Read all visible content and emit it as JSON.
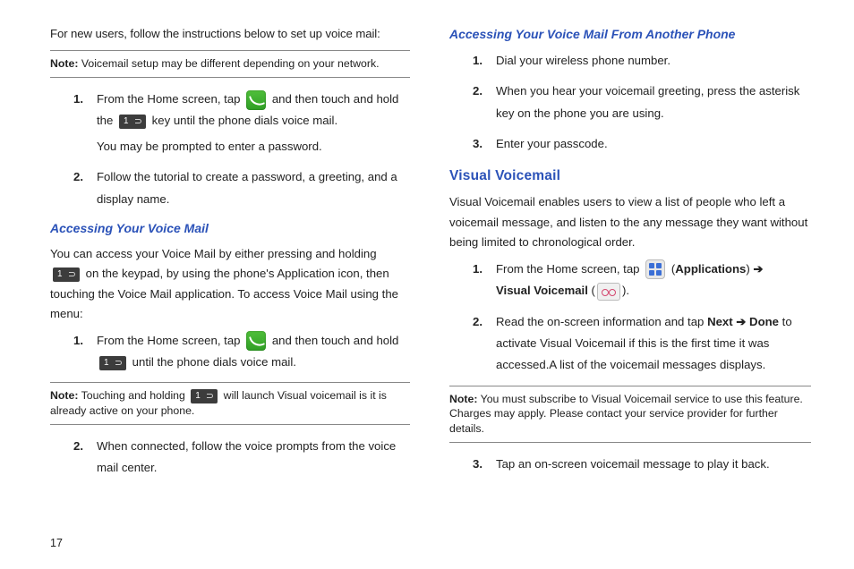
{
  "page_number": "17",
  "left": {
    "intro": "For new users, follow the instructions below to set up voice mail:",
    "note1_label": "Note:",
    "note1_text": " Voicemail setup may be different depending on your network.",
    "steps1": {
      "n1": "1.",
      "s1a": "From the Home screen, tap ",
      "s1b": " and then touch and hold the ",
      "s1c": " key until the phone dials voice mail.",
      "s1_sub": "You may be prompted to enter a password.",
      "n2": "2.",
      "s2": "Follow the tutorial to create a password, a greeting, and a display name."
    },
    "heading_access": "Accessing Your Voice Mail",
    "access_para_a": "You can access your Voice Mail by either pressing and holding ",
    "access_para_b": " on the keypad, by using the phone's Application icon, then touching the Voice Mail application. To access Voice Mail using the menu:",
    "steps2": {
      "n1": "1.",
      "s1a": "From the Home screen, tap ",
      "s1b": " and then touch and hold ",
      "s1c": " until the phone dials voice mail."
    },
    "note2_label": "Note:",
    "note2_a": " Touching and holding ",
    "note2_b": " will launch Visual voicemail is it is already active on your phone.",
    "steps3": {
      "n2": "2.",
      "s2": "When connected, follow the voice prompts from the voice mail center."
    },
    "key1_label": "1"
  },
  "right": {
    "heading_other": "Accessing Your Voice Mail From Another Phone",
    "other_steps": {
      "n1": "1.",
      "s1": "Dial your wireless phone number.",
      "n2": "2.",
      "s2": "When you hear your voicemail greeting, press the asterisk key on the phone you are using.",
      "n3": "3.",
      "s3": "Enter your passcode."
    },
    "heading_visual": "Visual Voicemail",
    "visual_para": "Visual Voicemail enables users to view a list of people who left a voicemail message, and listen to the any message they want without being limited to chronological order.",
    "vsteps": {
      "n1": "1.",
      "s1a": "From the Home screen, tap ",
      "s1_apps": "Applications",
      "s1_arrow": " ➔ ",
      "s1_vvm": "Visual Voicemail",
      "s1_open": " (",
      "s1_close": ").",
      "n2": "2.",
      "s2a": "Read the on-screen information and tap ",
      "s2_next": "Next",
      "s2_arrow": " ➔ ",
      "s2_done": "Done",
      "s2b": " to activate Visual Voicemail if this is the first time it was accessed.A list of the voicemail messages displays."
    },
    "note_label": "Note:",
    "note_text": " You must subscribe to Visual Voicemail service to use this feature. Charges may apply. Please contact your service provider for further details.",
    "vsteps2": {
      "n3": "3.",
      "s3": "Tap an on-screen voicemail message to play it back."
    }
  }
}
